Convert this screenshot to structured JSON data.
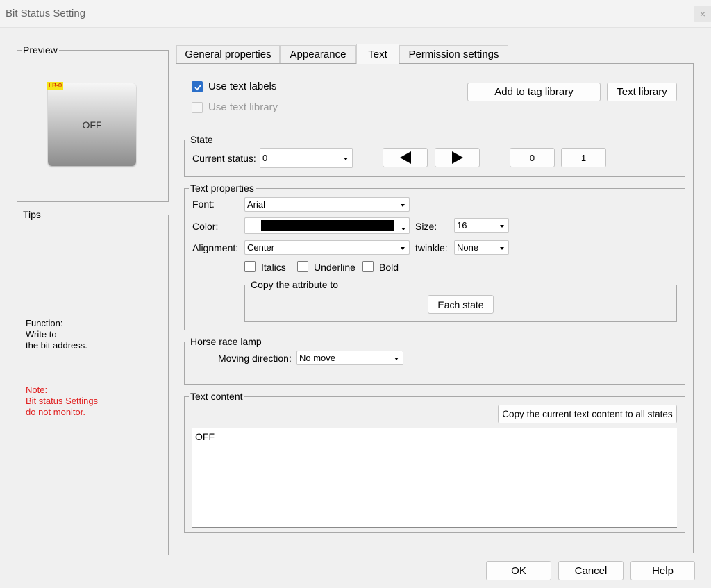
{
  "window": {
    "title": "Bit Status Setting",
    "close": "×"
  },
  "preview": {
    "title": "Preview",
    "badge": "LB-0",
    "button_text": "OFF"
  },
  "tips": {
    "title": "Tips",
    "function_lines": [
      "Function:",
      "Write to",
      "the bit address."
    ],
    "note_lines": [
      "Note:",
      "Bit status Settings",
      "do not monitor."
    ],
    "note_color": "#e02020"
  },
  "tabs": [
    {
      "label": "General properties"
    },
    {
      "label": "Appearance"
    },
    {
      "label": "Text",
      "active": true
    },
    {
      "label": "Permission settings"
    }
  ],
  "text_tab": {
    "use_text_labels": {
      "label": "Use text labels",
      "checked": true
    },
    "use_text_library": {
      "label": "Use text library",
      "checked": false,
      "disabled": true
    },
    "add_to_tag_library": "Add to tag library",
    "text_library": "Text library",
    "state": {
      "title": "State",
      "current_status_label": "Current status:",
      "current_status_value": "0",
      "state0": "0",
      "state1": "1"
    },
    "text_properties": {
      "title": "Text properties",
      "font_label": "Font:",
      "font_value": "Arial",
      "color_label": "Color:",
      "color_value": "#000000",
      "size_label": "Size:",
      "size_value": "16",
      "alignment_label": "Alignment:",
      "alignment_value": "Center",
      "twinkle_label": "twinkle:",
      "twinkle_value": "None",
      "italics": "Italics",
      "underline": "Underline",
      "bold": "Bold",
      "copy_attr_title": "Copy the attribute to",
      "each_state": "Each state"
    },
    "horse_race_lamp": {
      "title": "Horse race lamp",
      "moving_direction_label": "Moving direction:",
      "moving_direction_value": "No move"
    },
    "text_content": {
      "title": "Text content",
      "copy_button": "Copy the current text content to all states",
      "value": "OFF"
    }
  },
  "footer": {
    "ok": "OK",
    "cancel": "Cancel",
    "help": "Help"
  }
}
